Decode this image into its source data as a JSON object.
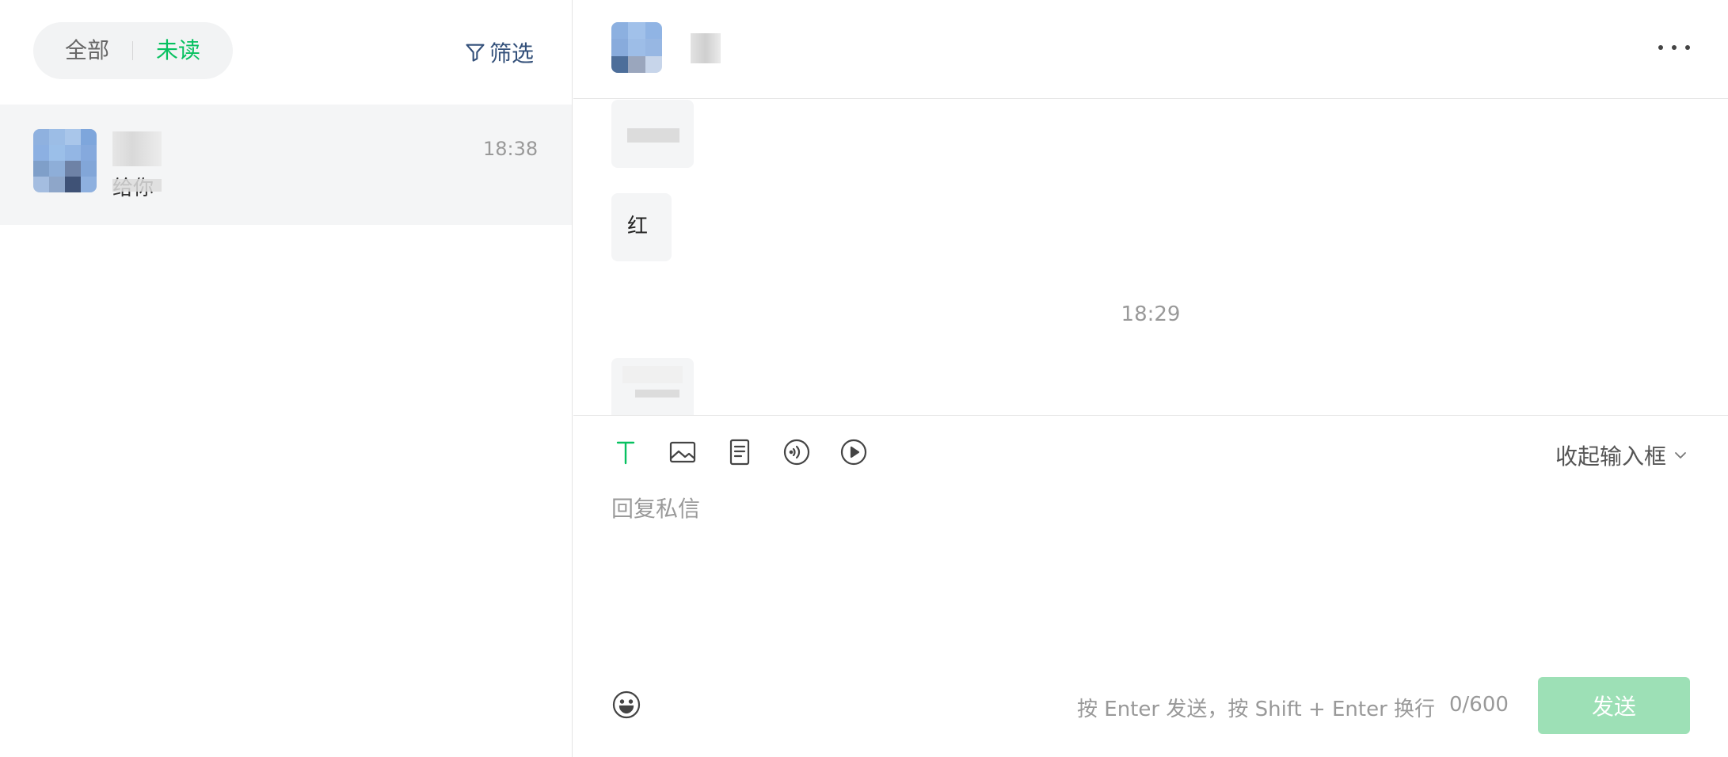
{
  "conversation_list": {
    "tabs": {
      "all_label": "全部",
      "unread_label": "未读"
    },
    "filter_label": "筛选",
    "items": [
      {
        "preview": "给你",
        "time": "18:38"
      }
    ]
  },
  "chat": {
    "more_icon": "more-horizontal-icon",
    "messages": [
      {
        "text": ""
      },
      {
        "text": "红"
      },
      {
        "text": ""
      }
    ],
    "timestamp": "18:29"
  },
  "composer": {
    "tools": [
      "text-icon",
      "image-icon",
      "document-icon",
      "audio-icon",
      "video-icon"
    ],
    "collapse_label": "收起输入框",
    "placeholder": "回复私信",
    "hint": "按 Enter 发送，按 Shift + Enter 换行",
    "counter": "0/600",
    "send_label": "发送"
  },
  "colors": {
    "accent": "#07c160",
    "send_disabled": "#9de0b6",
    "filter_text": "#33507a"
  }
}
